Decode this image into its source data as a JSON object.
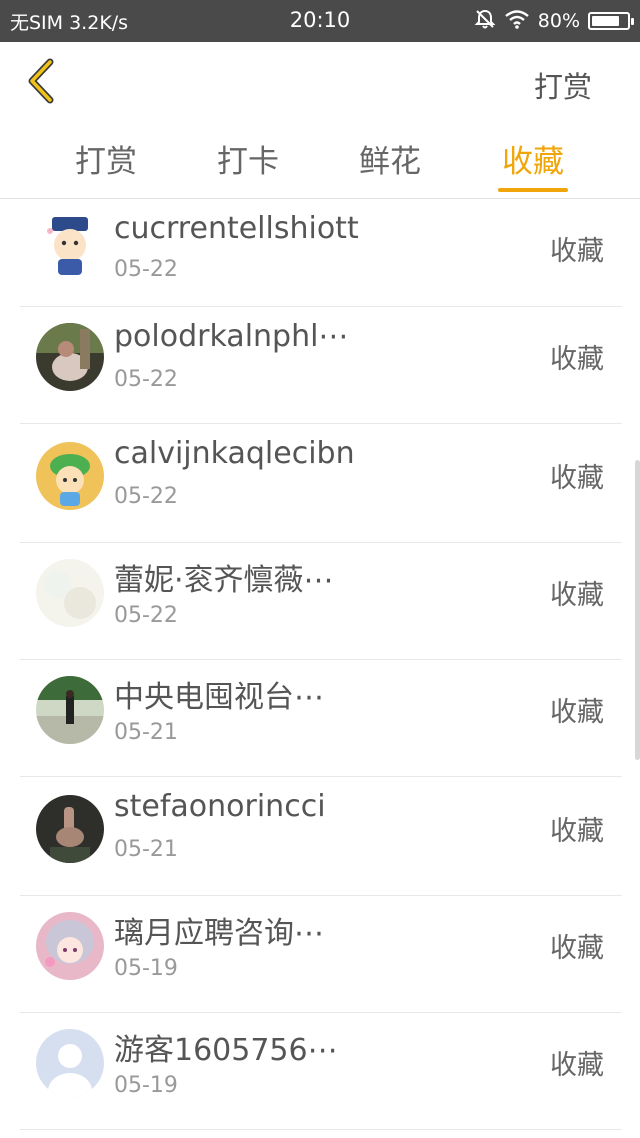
{
  "status_bar": {
    "carrier": "无SIM 3.2K/s",
    "time": "20:10",
    "battery_text": "80%",
    "battery_level": 0.8,
    "icons": [
      "mute-bell-icon",
      "wifi-icon",
      "battery-icon"
    ]
  },
  "header": {
    "back_icon": "chevron-left-icon",
    "action_label": "打赏"
  },
  "tabs": [
    {
      "label": "打赏",
      "active": false
    },
    {
      "label": "打卡",
      "active": false
    },
    {
      "label": "鲜花",
      "active": false
    },
    {
      "label": "收藏",
      "active": true
    }
  ],
  "colors": {
    "accent": "#f0a50a",
    "status_bar_bg": "#4a4a4a",
    "text_primary": "#555555",
    "text_secondary": "#999999"
  },
  "items": [
    {
      "name": "cucrrentellshiott",
      "date": "05-22",
      "type": "收藏",
      "avatar": "cartoon-boy-avatar"
    },
    {
      "name": "polodrkalnphl⋯",
      "date": "05-22",
      "type": "收藏",
      "avatar": "photo-avatar"
    },
    {
      "name": "calvijnkaqlecibn",
      "date": "05-22",
      "type": "收藏",
      "avatar": "green-cartoon-avatar"
    },
    {
      "name": "蕾妮·衮齐懔薇⋯",
      "date": "05-22",
      "type": "收藏",
      "avatar": "light-pastel-avatar"
    },
    {
      "name": "中央电囤视台⋯",
      "date": "05-21",
      "type": "收藏",
      "avatar": "outdoor-photo-avatar"
    },
    {
      "name": "stefaonorincci",
      "date": "05-21",
      "type": "收藏",
      "avatar": "dark-gesture-avatar"
    },
    {
      "name": "璃月应聘咨询⋯",
      "date": "05-19",
      "type": "收藏",
      "avatar": "anime-girl-avatar"
    },
    {
      "name": "游客1605756⋯",
      "date": "05-19",
      "type": "收藏",
      "avatar": "default-user-avatar"
    }
  ]
}
